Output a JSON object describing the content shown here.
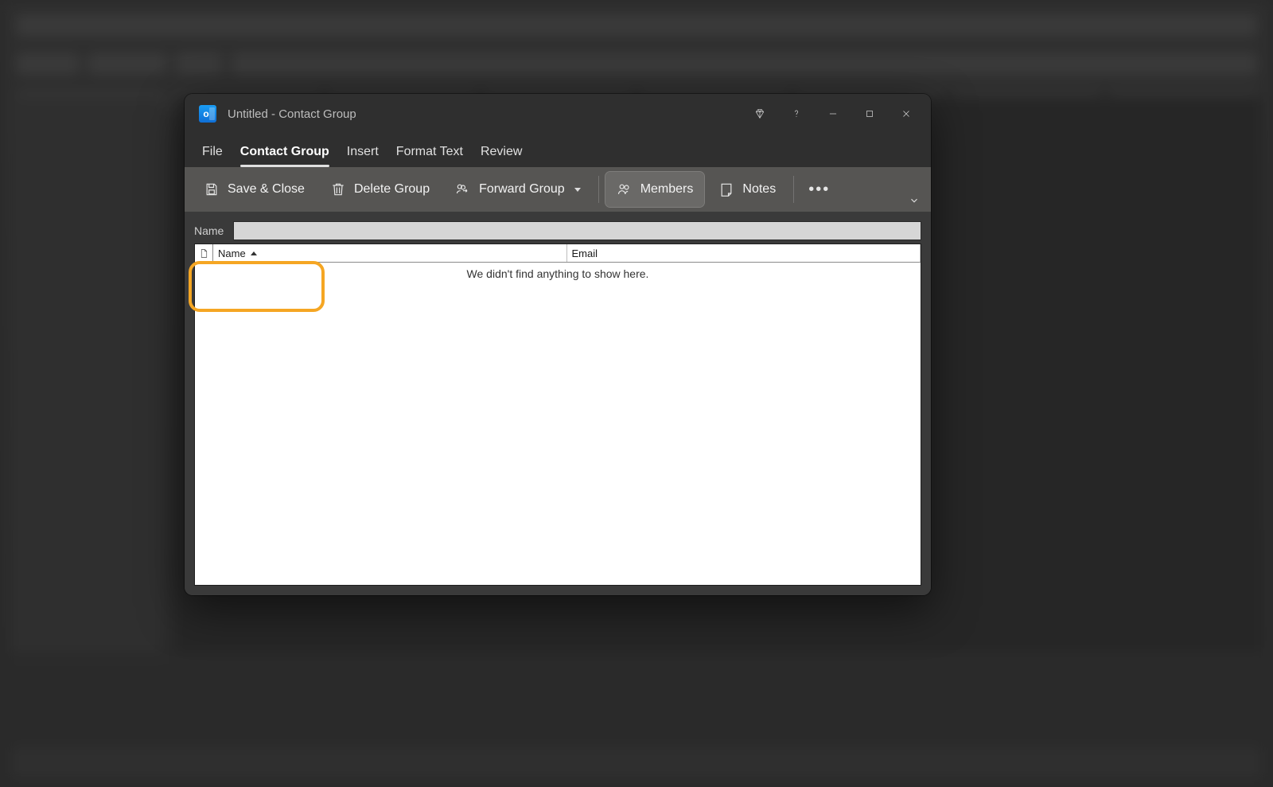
{
  "titlebar": {
    "app_letter": "o",
    "title": "Untitled  -  Contact Group"
  },
  "tabs": [
    {
      "label": "File",
      "active": false
    },
    {
      "label": "Contact Group",
      "active": true
    },
    {
      "label": "Insert",
      "active": false
    },
    {
      "label": "Format Text",
      "active": false
    },
    {
      "label": "Review",
      "active": false
    }
  ],
  "ribbon": {
    "save_close": "Save & Close",
    "delete_group": "Delete Group",
    "forward_group": "Forward Group",
    "members": "Members",
    "notes": "Notes"
  },
  "body": {
    "name_label": "Name",
    "name_value": "",
    "columns": {
      "name": "Name",
      "email": "Email"
    },
    "empty": "We didn't find anything to show here."
  }
}
